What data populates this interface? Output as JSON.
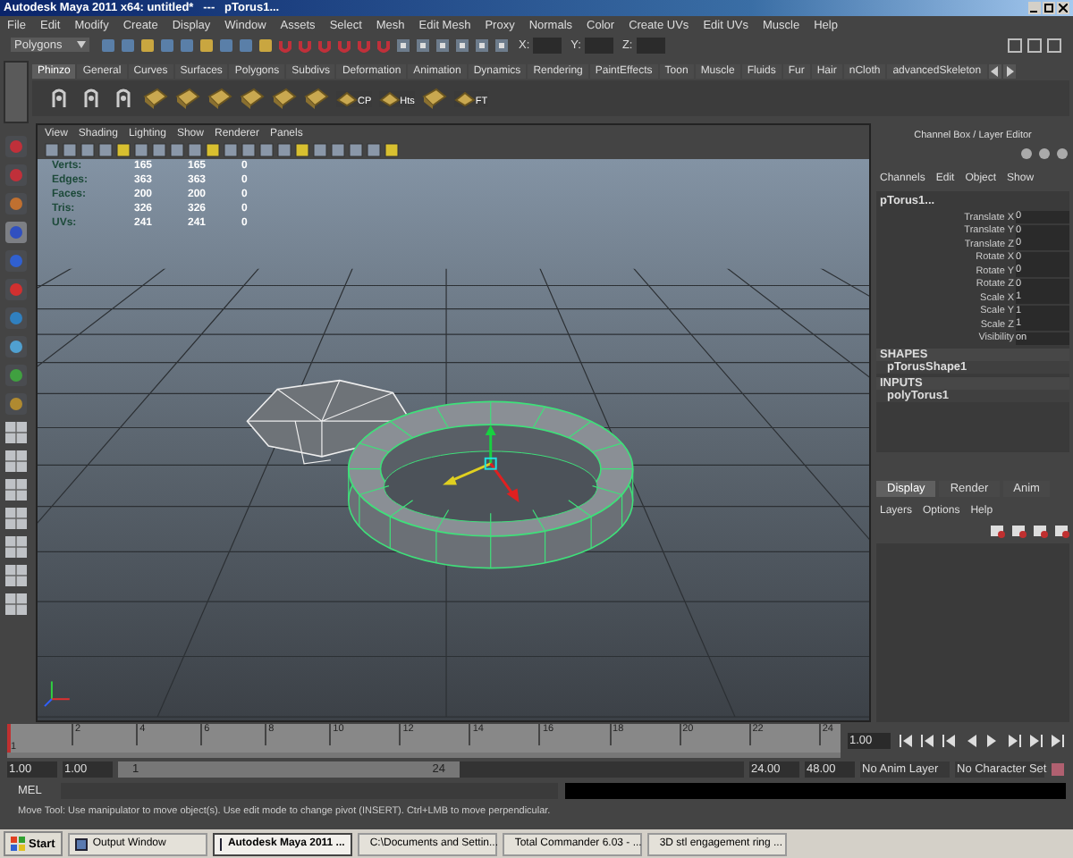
{
  "window": {
    "title": "Autodesk Maya 2011 x64: untitled*   ---   pTorus1..."
  },
  "menu": [
    "File",
    "Edit",
    "Modify",
    "Create",
    "Display",
    "Window",
    "Assets",
    "Select",
    "Mesh",
    "Edit Mesh",
    "Proxy",
    "Normals",
    "Color",
    "Create UVs",
    "Edit UVs",
    "Muscle",
    "Help"
  ],
  "status_line": {
    "mode": "Polygons",
    "coords": [
      "X:",
      "Y:",
      "Z:"
    ]
  },
  "shelf": {
    "tabs": [
      {
        "label": "Phinzo",
        "selected": true
      },
      {
        "label": "General",
        "selected": false
      },
      {
        "label": "Curves",
        "selected": false
      },
      {
        "label": "Surfaces",
        "selected": false
      },
      {
        "label": "Polygons",
        "selected": false
      },
      {
        "label": "Subdivs",
        "selected": false
      },
      {
        "label": "Deformation",
        "selected": false
      },
      {
        "label": "Animation",
        "selected": false
      },
      {
        "label": "Dynamics",
        "selected": false
      },
      {
        "label": "Rendering",
        "selected": false
      },
      {
        "label": "PaintEffects",
        "selected": false
      },
      {
        "label": "Toon",
        "selected": false
      },
      {
        "label": "Muscle",
        "selected": false
      },
      {
        "label": "Fluids",
        "selected": false
      },
      {
        "label": "Fur",
        "selected": false
      },
      {
        "label": "Hair",
        "selected": false
      },
      {
        "label": "nCloth",
        "selected": false
      },
      {
        "label": "advancedSkeleton",
        "selected": false
      }
    ],
    "buttons": [
      {
        "kind": "script"
      },
      {
        "kind": "script"
      },
      {
        "kind": "script"
      },
      {
        "kind": "tile"
      },
      {
        "kind": "tile"
      },
      {
        "kind": "tile"
      },
      {
        "kind": "tile"
      },
      {
        "kind": "tile"
      },
      {
        "kind": "tile"
      },
      {
        "kind": "labeled",
        "label": "CP"
      },
      {
        "kind": "labeled",
        "label": "Hts"
      },
      {
        "kind": "tile"
      },
      {
        "kind": "labeled",
        "label": "FT"
      }
    ]
  },
  "viewport": {
    "menu": [
      "View",
      "Shading",
      "Lighting",
      "Show",
      "Renderer",
      "Panels"
    ],
    "hud": [
      {
        "label": "Verts:",
        "values": [
          "165",
          "165",
          "0"
        ]
      },
      {
        "label": "Edges:",
        "values": [
          "363",
          "363",
          "0"
        ]
      },
      {
        "label": "Faces:",
        "values": [
          "200",
          "200",
          "0"
        ]
      },
      {
        "label": "Tris:",
        "values": [
          "326",
          "326",
          "0"
        ]
      },
      {
        "label": "UVs:",
        "values": [
          "241",
          "241",
          "0"
        ]
      }
    ]
  },
  "channel_box": {
    "title": "Channel Box / Layer Editor",
    "menu": [
      "Channels",
      "Edit",
      "Object",
      "Show"
    ],
    "object": "pTorus1...",
    "attributes": [
      {
        "name": "Translate X",
        "value": "0"
      },
      {
        "name": "Translate Y",
        "value": "0"
      },
      {
        "name": "Translate Z",
        "value": "0"
      },
      {
        "name": "Rotate X",
        "value": "0"
      },
      {
        "name": "Rotate Y",
        "value": "0"
      },
      {
        "name": "Rotate Z",
        "value": "0"
      },
      {
        "name": "Scale X",
        "value": "1"
      },
      {
        "name": "Scale Y",
        "value": "1"
      },
      {
        "name": "Scale Z",
        "value": "1"
      },
      {
        "name": "Visibility",
        "value": "on"
      }
    ],
    "sections": [
      {
        "heading": "SHAPES",
        "items": [
          "pTorusShape1"
        ]
      },
      {
        "heading": "INPUTS",
        "items": [
          "polyTorus1"
        ]
      }
    ]
  },
  "layer_editor": {
    "tabs": [
      {
        "label": "Display",
        "selected": true
      },
      {
        "label": "Render",
        "selected": false
      },
      {
        "label": "Anim",
        "selected": false
      }
    ],
    "menu": [
      "Layers",
      "Options",
      "Help"
    ]
  },
  "time_slider": {
    "level": 0,
    "start": "1",
    "ticks": [
      "2",
      "4",
      "6",
      "8",
      "10",
      "12",
      "14",
      "16",
      "18",
      "20",
      "22",
      "24"
    ],
    "current": "1.00"
  },
  "range": {
    "level": 0.5,
    "start": "1.00",
    "inner_start": "1.00",
    "slider_start": "1",
    "slider_end": "24",
    "inner_end": "24.00",
    "end": "48.00",
    "anim_layer": "No Anim Layer",
    "character_set": "No Character Set"
  },
  "command_line": {
    "label": "MEL"
  },
  "help_line": "Move Tool: Use manipulator to move object(s). Use edit mode to change pivot (INSERT). Ctrl+LMB to move perpendicular.",
  "taskbar": {
    "start": "Start",
    "tasks": [
      {
        "label": "Output Window",
        "selected": false
      },
      {
        "label": "Autodesk Maya 2011 ...",
        "selected": true
      },
      {
        "label": "C:\\Documents and Settin...",
        "selected": false
      },
      {
        "label": "Total Commander 6.03 - ...",
        "selected": false
      },
      {
        "label": "3D stl engagement ring ...",
        "selected": false
      }
    ]
  }
}
